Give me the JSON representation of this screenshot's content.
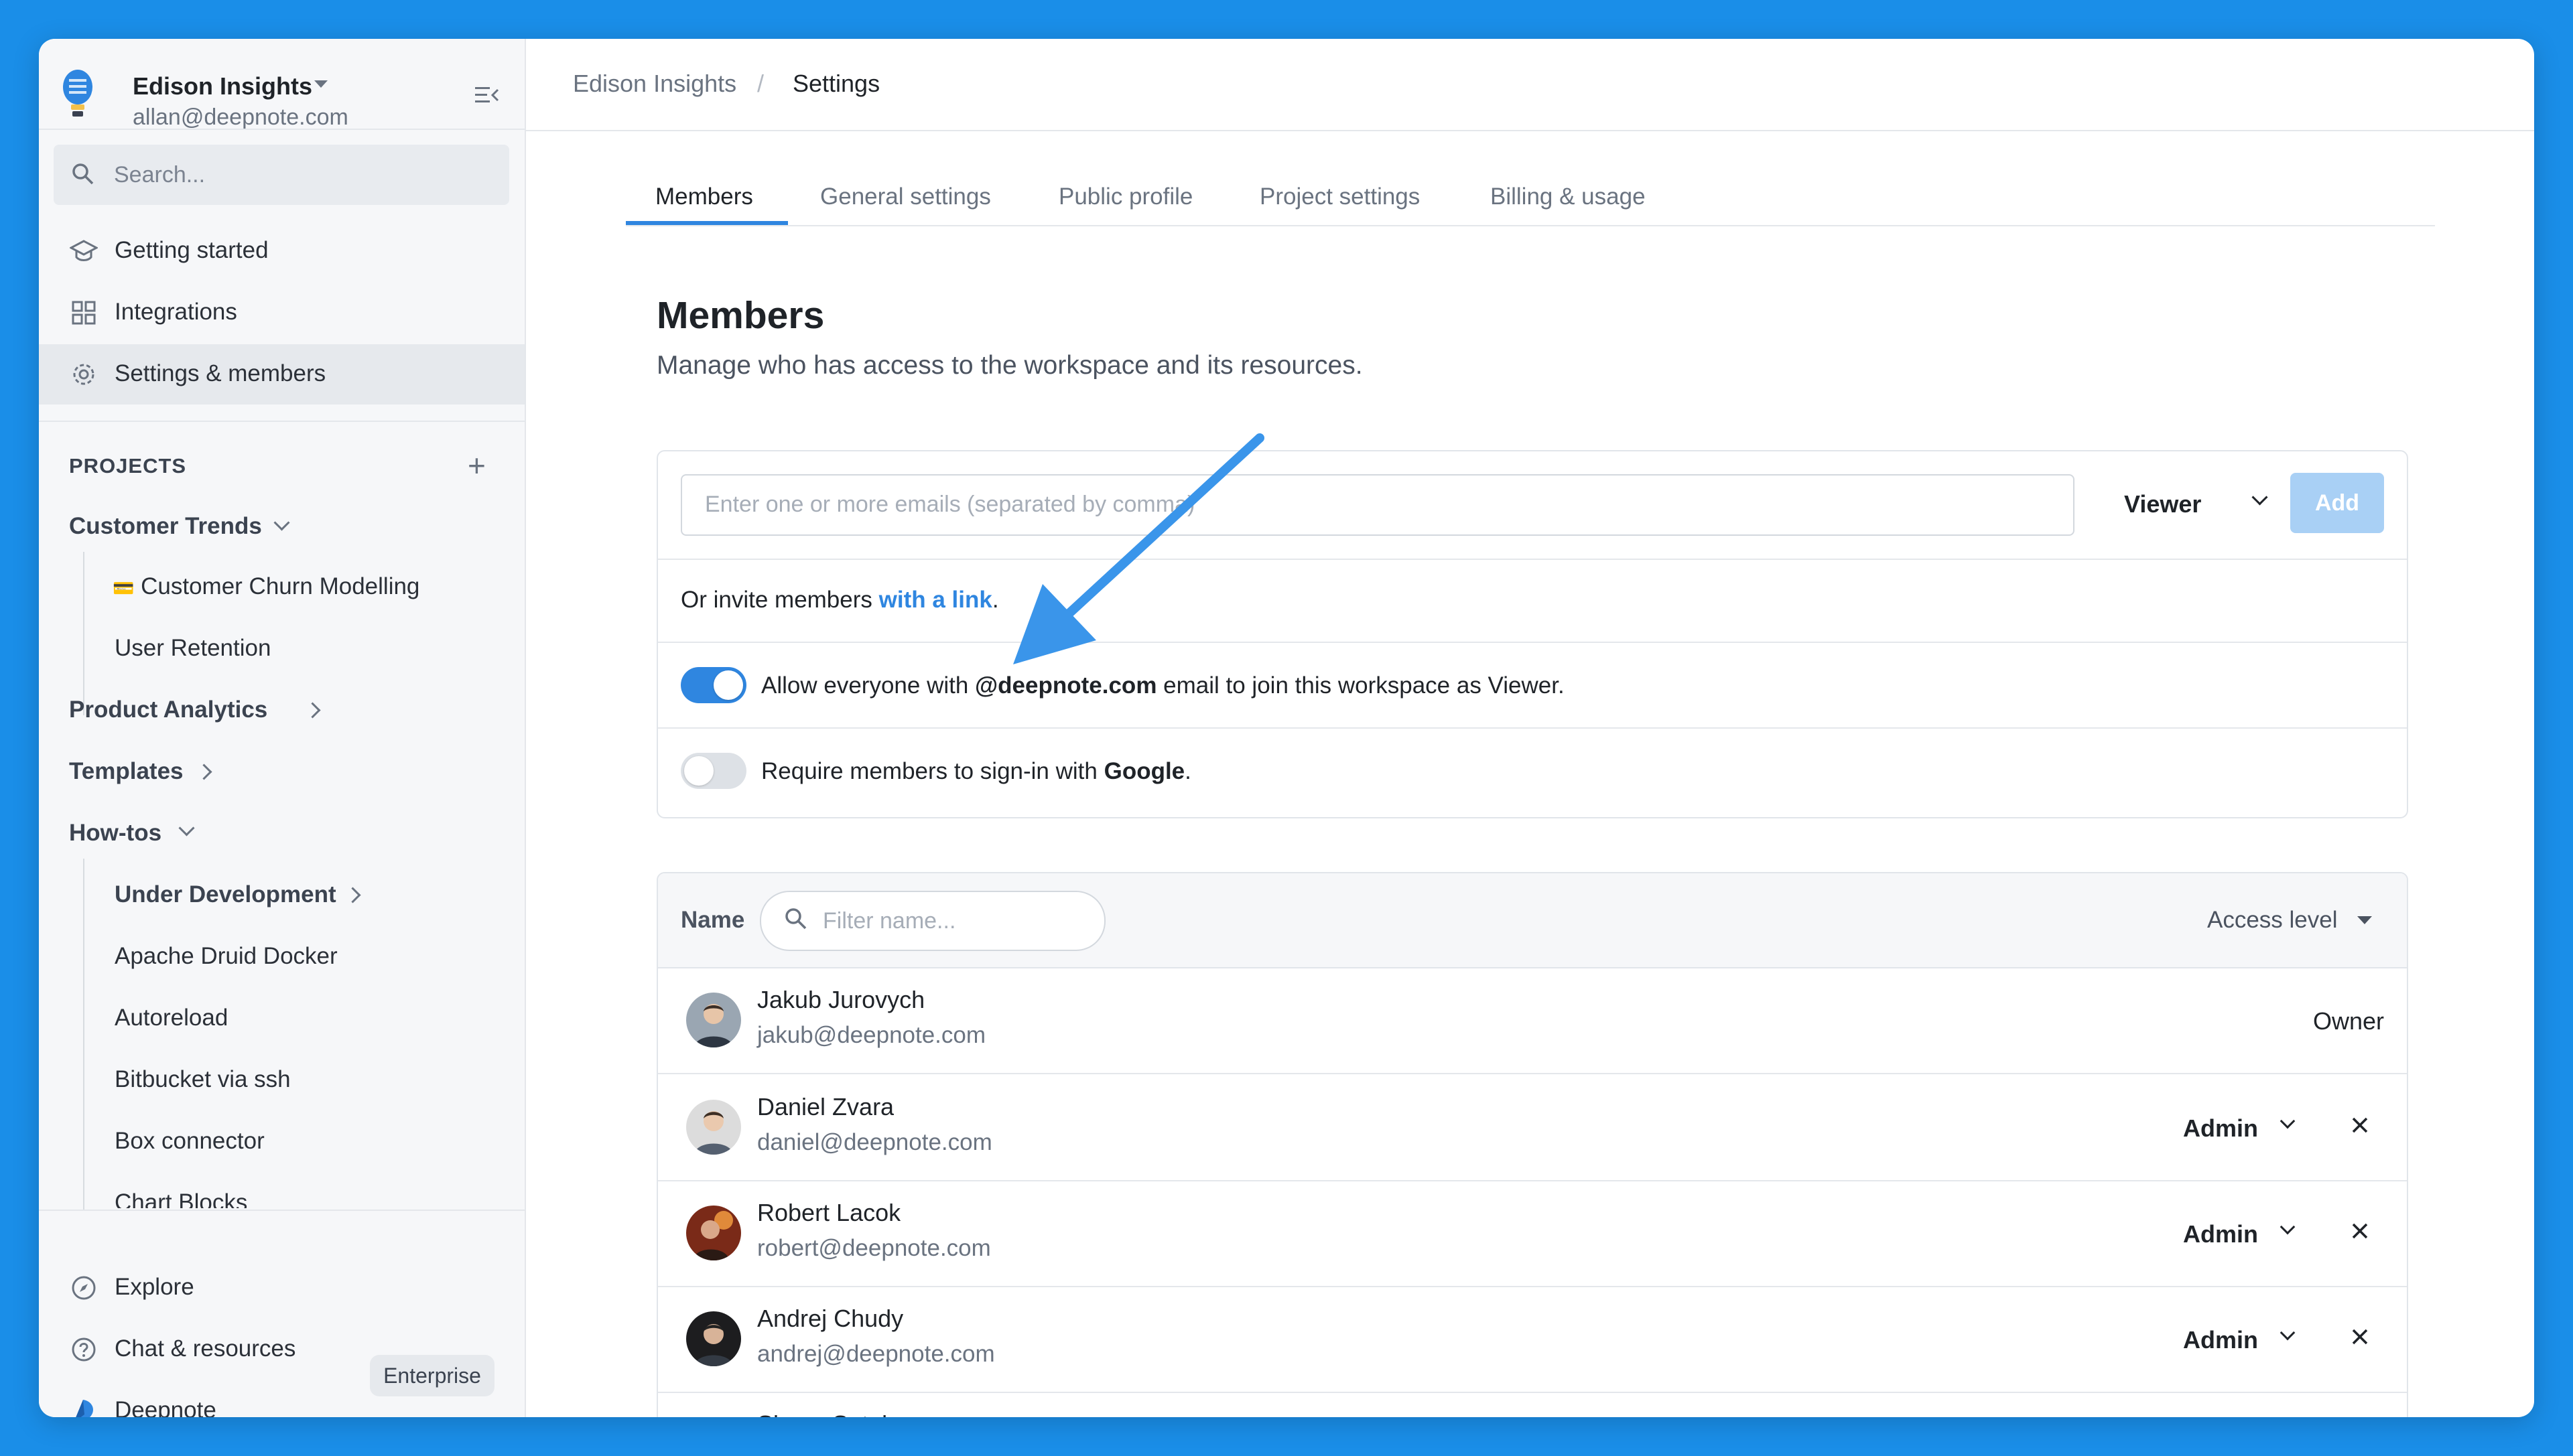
{
  "workspace": {
    "name": "Edison Insights",
    "email": "allan@deepnote.com"
  },
  "sidebar": {
    "search_placeholder": "Search...",
    "nav": [
      {
        "label": "Getting started",
        "icon": "graduation-cap-icon"
      },
      {
        "label": "Integrations",
        "icon": "grid-icon"
      },
      {
        "label": "Settings & members",
        "icon": "gear-icon",
        "active": true
      }
    ],
    "projects_title": "PROJECTS",
    "projects": {
      "customer_trends": "Customer Trends",
      "churn_modelling_emoji": "💳",
      "churn_modelling": "Customer Churn Modelling",
      "user_retention": "User Retention",
      "product_analytics": "Product Analytics",
      "templates": "Templates",
      "how_tos": "How-tos",
      "under_development": "Under Development",
      "apache_druid": "Apache Druid Docker",
      "autoreload": "Autoreload",
      "bitbucket": "Bitbucket via ssh",
      "box_connector": "Box connector",
      "chart_blocks": "Chart Blocks"
    },
    "bottom": {
      "explore": "Explore",
      "chat": "Chat & resources",
      "deepnote": "Deepnote",
      "plan_badge": "Enterprise"
    }
  },
  "breadcrumb": {
    "workspace": "Edison Insights",
    "separator": "/",
    "current": "Settings"
  },
  "tabs": [
    {
      "label": "Members",
      "active": true
    },
    {
      "label": "General settings"
    },
    {
      "label": "Public profile"
    },
    {
      "label": "Project settings"
    },
    {
      "label": "Billing & usage"
    }
  ],
  "page": {
    "title": "Members",
    "subtitle": "Manage who has access to the workspace and its resources."
  },
  "invite": {
    "email_placeholder": "Enter one or more emails (separated by comma)",
    "role": "Viewer",
    "add_label": "Add",
    "link_prefix": "Or invite members ",
    "link_text": "with a link",
    "link_suffix": ".",
    "allow_domain": {
      "prefix": "Allow everyone with ",
      "domain": "@deepnote.com",
      "suffix": " email to join this workspace as Viewer.",
      "enabled": true
    },
    "require_google": {
      "prefix": "Require members to sign-in with ",
      "provider": "Google",
      "suffix": ".",
      "enabled": false
    }
  },
  "members_table": {
    "name_header": "Name",
    "filter_placeholder": "Filter name...",
    "access_header": "Access level",
    "rows": [
      {
        "name": "Jakub Jurovych",
        "email": "jakub@deepnote.com",
        "role": "Owner"
      },
      {
        "name": "Daniel Zvara",
        "email": "daniel@deepnote.com",
        "role": "Admin"
      },
      {
        "name": "Robert Lacok",
        "email": "robert@deepnote.com",
        "role": "Admin"
      },
      {
        "name": "Andrej Chudy",
        "email": "andrej@deepnote.com",
        "role": "Admin"
      },
      {
        "name": "Simon Sotak",
        "email": "",
        "role": ""
      }
    ]
  },
  "colors": {
    "accent": "#2f86e0",
    "background": "#1a8ee8",
    "add_button_disabled": "#a9d0f5",
    "annotation_arrow": "#3a95ea"
  }
}
